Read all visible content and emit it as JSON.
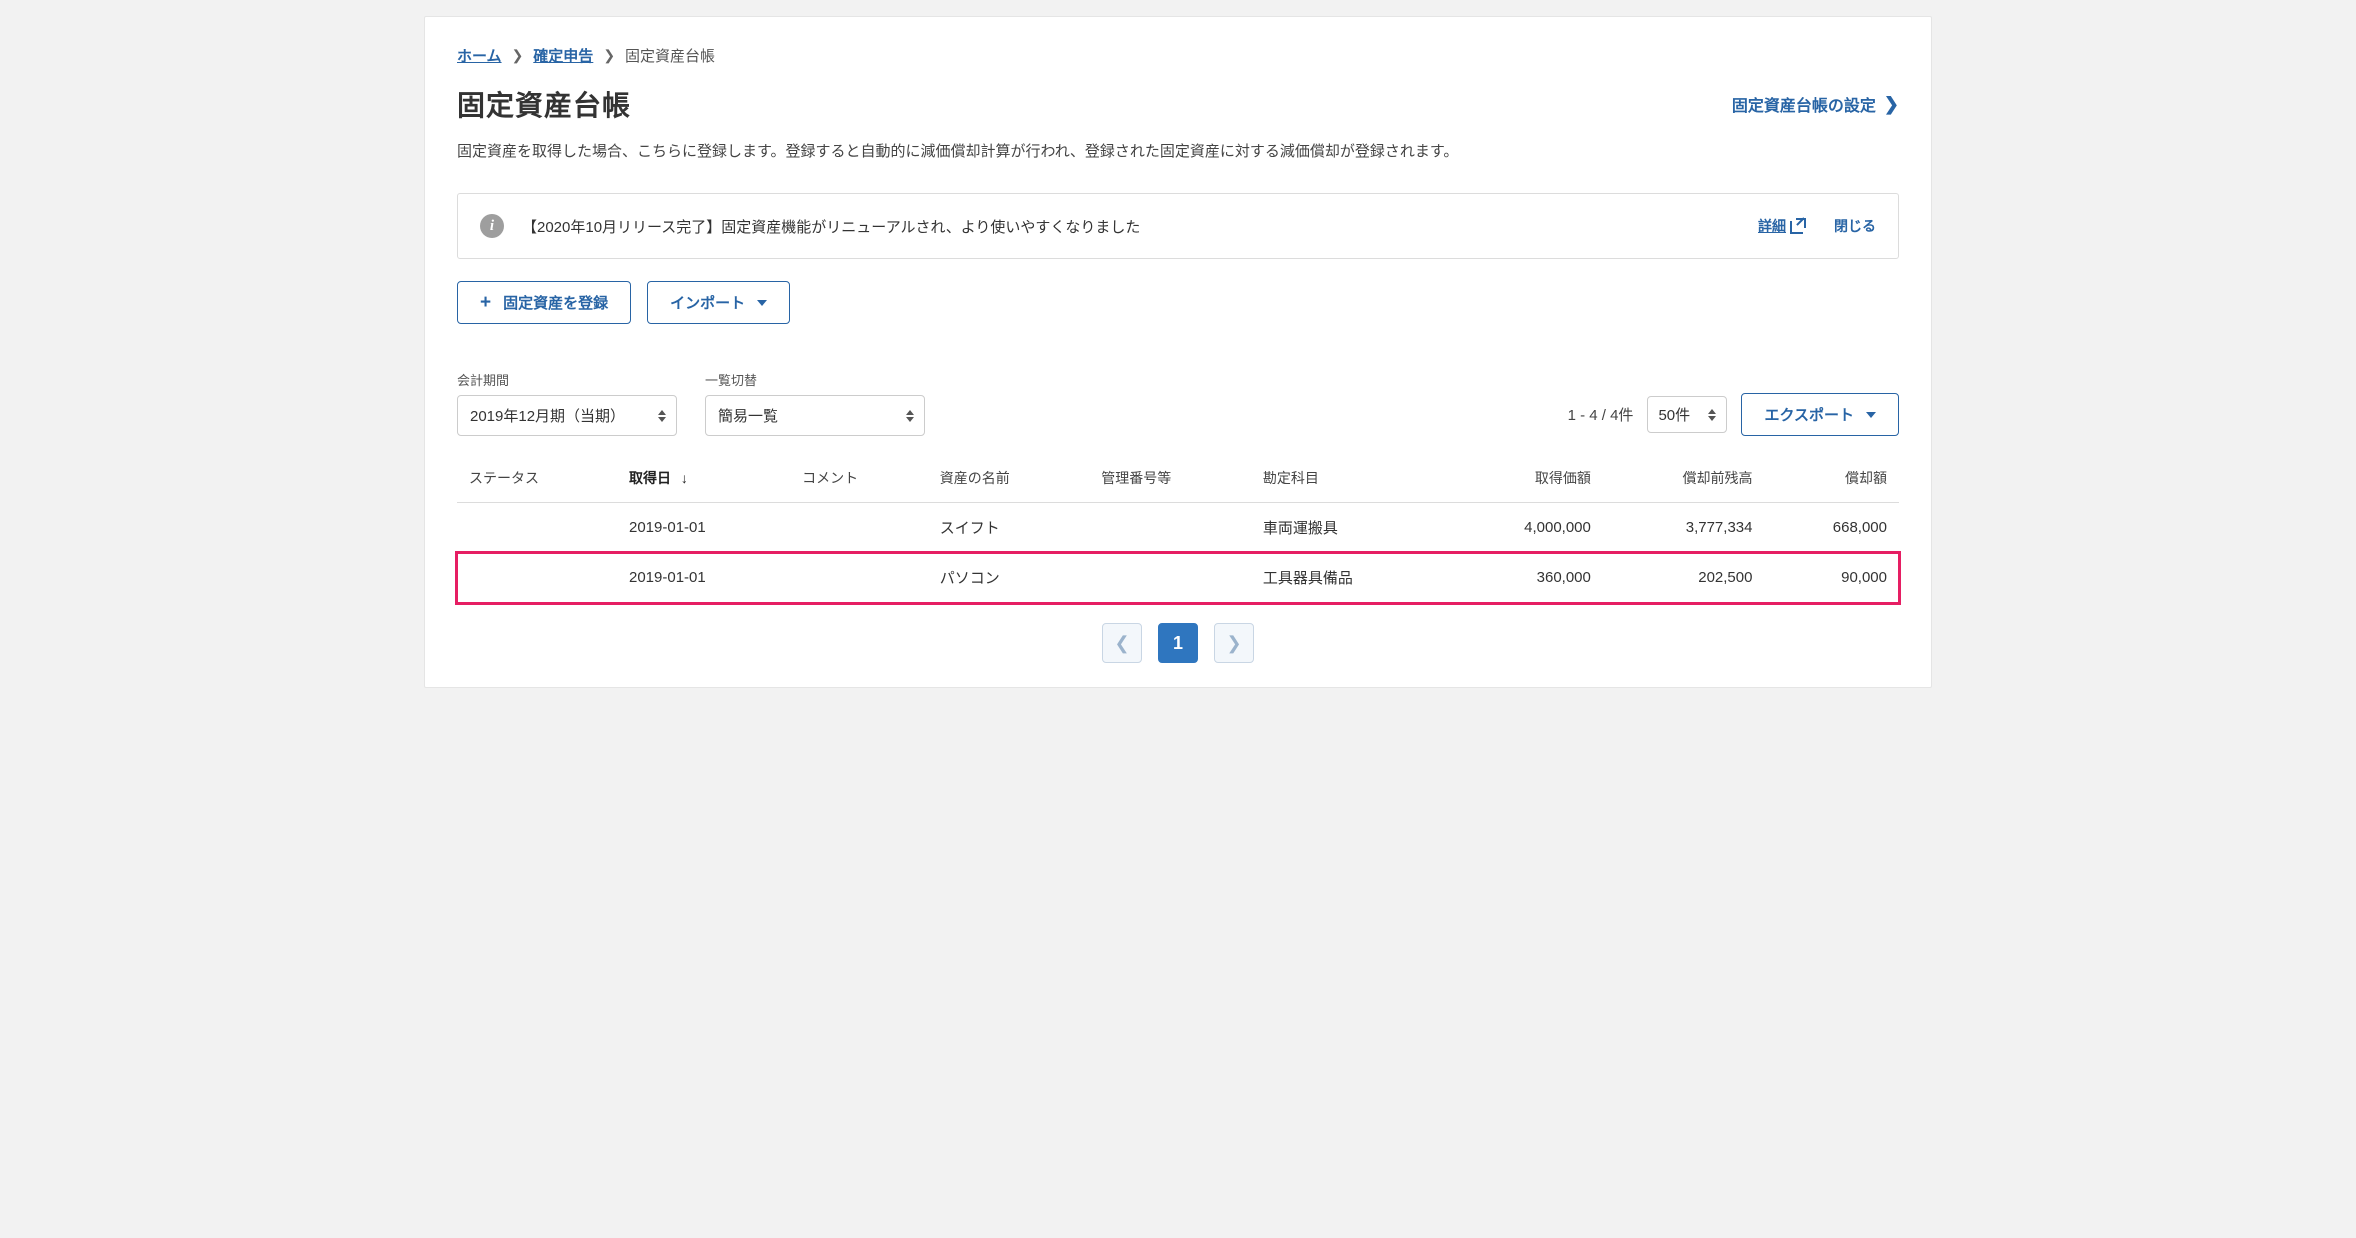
{
  "breadcrumb": {
    "home": "ホーム",
    "tax": "確定申告",
    "current": "固定資産台帳"
  },
  "page": {
    "title": "固定資産台帳",
    "settings_link": "固定資産台帳の設定",
    "description": "固定資産を取得した場合、こちらに登録します。登録すると自動的に減価償却計算が行われ、登録された固定資産に対する減価償却が登録されます。"
  },
  "banner": {
    "text": "【2020年10月リリース完了】固定資産機能がリニューアルされ、より使いやすくなりました",
    "detail": "詳細",
    "close": "閉じる"
  },
  "actions": {
    "register": "固定資産を登録",
    "import": "インポート"
  },
  "filters": {
    "period_label": "会計期間",
    "period_value": "2019年12月期（当期）",
    "view_label": "一覧切替",
    "view_value": "簡易一覧",
    "count_text": "1 - 4 / 4件",
    "pagesize": "50件",
    "export": "エクスポート"
  },
  "table": {
    "headers": {
      "status": "ステータス",
      "date": "取得日",
      "comment": "コメント",
      "name": "資産の名前",
      "number": "管理番号等",
      "account": "勘定科目",
      "cost": "取得価額",
      "balance": "償却前残高",
      "dep": "償却額"
    },
    "rows": [
      {
        "status": "",
        "date": "2019-01-01",
        "comment": "",
        "name": "スイフト",
        "number": "",
        "account": "車両運搬具",
        "cost": "4,000,000",
        "balance": "3,777,334",
        "dep": "668,000",
        "highlight": false
      },
      {
        "status": "",
        "date": "2019-01-01",
        "comment": "",
        "name": "パソコン",
        "number": "",
        "account": "工具器具備品",
        "cost": "360,000",
        "balance": "202,500",
        "dep": "90,000",
        "highlight": true
      }
    ]
  },
  "pagination": {
    "current": "1"
  }
}
